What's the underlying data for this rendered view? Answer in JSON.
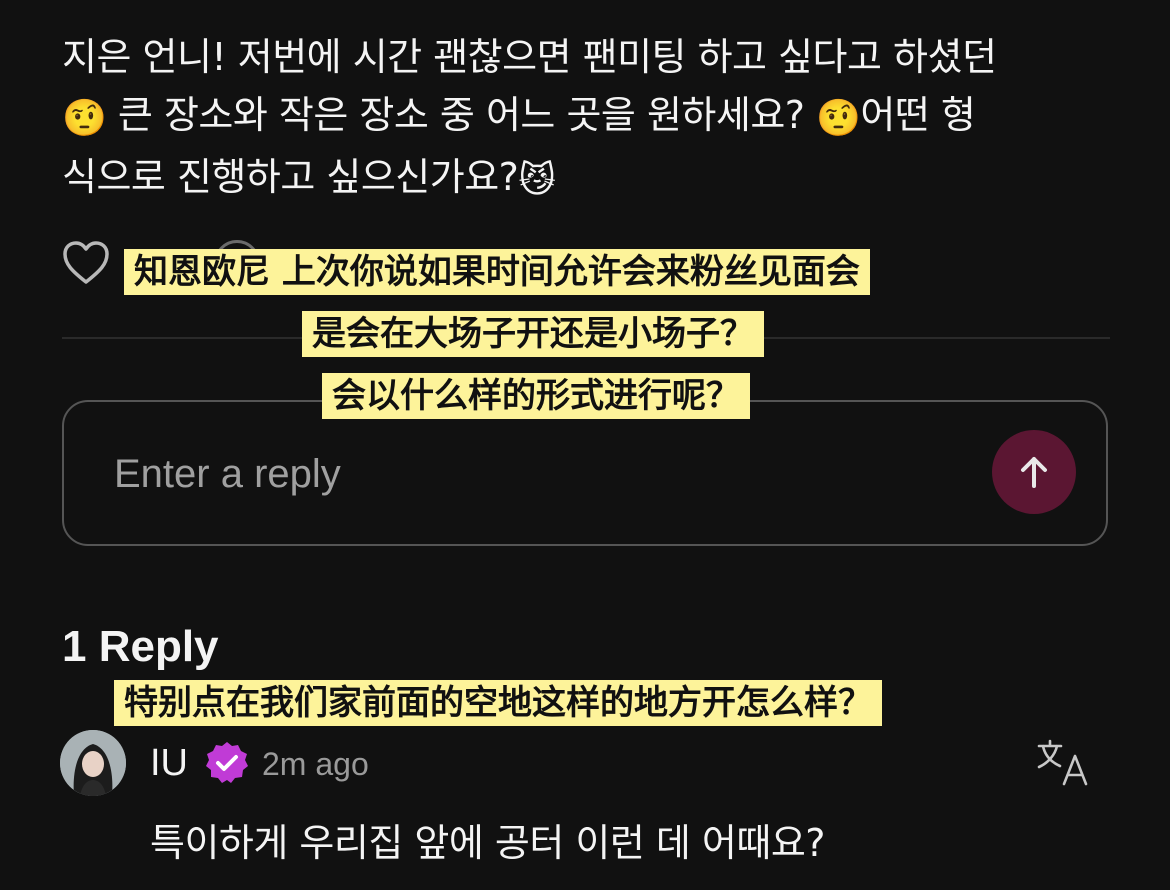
{
  "post": {
    "line1": "지은 언니! 저번에 시간 괜찮으면 팬미팅 하고 싶다고 하셨던",
    "line2_emoji_a": "🤨",
    "line2_text": " 큰 장소와 작은 장소 중 어느 곳을 원하세요? ",
    "line2_emoji_b": "🤨",
    "line2_text_b": "어떤 형",
    "line3_text": "식으로 진행하고 싶으신가요?",
    "line3_emoji": "😼"
  },
  "subtitles": {
    "s1": "知恩欧尼 上次你说如果时间允许会来粉丝见面会",
    "s2": "是会在大场子开还是小场子？",
    "s3": "会以什么样的形式进行呢？",
    "s4": "特别点在我们家前面的空地这样的地方开怎么样？"
  },
  "reply_box": {
    "placeholder": "Enter a reply"
  },
  "replies": {
    "count_label": "1 Reply",
    "items": [
      {
        "username": "IU",
        "time": "2m ago",
        "text": "특이하게 우리집 앞에 공터 이런 데 어때요?"
      }
    ]
  },
  "colors": {
    "background": "#111111",
    "send_button": "#5b1632",
    "verified_badge": "#c03bd6",
    "subtitle_bg": "#fdf39a"
  },
  "icons": [
    "heart-icon",
    "arrow-up-icon",
    "verified-badge-icon",
    "translate-icon"
  ]
}
